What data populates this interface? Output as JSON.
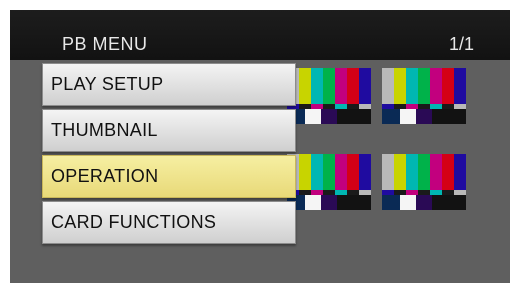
{
  "header": {
    "title": "PB MENU",
    "page_indicator": "1/1"
  },
  "menu": {
    "items": [
      {
        "label": "PLAY SETUP",
        "selected": false
      },
      {
        "label": "THUMBNAIL",
        "selected": false
      },
      {
        "label": "OPERATION",
        "selected": true
      },
      {
        "label": "CARD FUNCTIONS",
        "selected": false
      }
    ]
  },
  "colors": {
    "background": "#5f5f5f",
    "header": "#161616",
    "highlight": "#efe38c",
    "item": "#e0e0e0"
  },
  "thumbnails": [
    {
      "icon": "color-bars-thumbnail"
    },
    {
      "icon": "color-bars-thumbnail"
    },
    {
      "icon": "color-bars-thumbnail"
    },
    {
      "icon": "color-bars-thumbnail"
    }
  ]
}
